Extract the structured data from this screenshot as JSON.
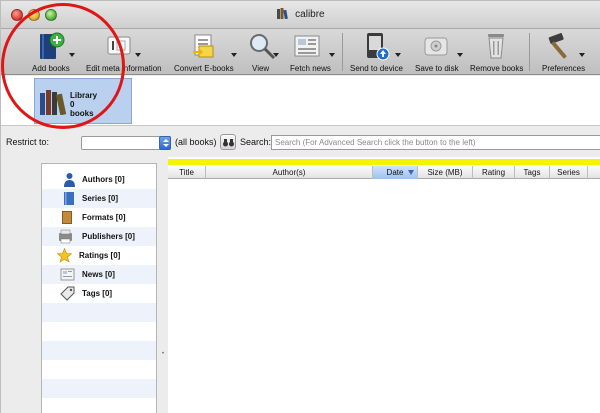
{
  "window": {
    "title": "calibre"
  },
  "toolbar": {
    "items": [
      {
        "label": "Add books",
        "icon": "add-books-icon"
      },
      {
        "label": "Edit meta information",
        "icon": "edit-metadata-icon"
      },
      {
        "label": "Convert E-books",
        "icon": "convert-icon"
      },
      {
        "label": "View",
        "icon": "view-magnifier-icon"
      },
      {
        "label": "Fetch news",
        "icon": "fetch-news-icon"
      },
      {
        "label": "Send to device",
        "icon": "send-to-device-icon"
      },
      {
        "label": "Save to disk",
        "icon": "save-to-disk-icon"
      },
      {
        "label": "Remove books",
        "icon": "trash-icon"
      },
      {
        "label": "Preferences",
        "icon": "preferences-hammer-icon"
      }
    ]
  },
  "library": {
    "line1": "Library",
    "line2": "0",
    "line3": "books"
  },
  "filter": {
    "restrict_label": "Restrict to:",
    "restrict_value": "",
    "all_books": "(all books)",
    "search_label": "Search:",
    "search_placeholder": "Search (For Advanced Search click the button to the left)"
  },
  "tag_browser": {
    "items": [
      {
        "label": "Authors [0]",
        "icon": "person-icon"
      },
      {
        "label": "Series [0]",
        "icon": "series-book-icon"
      },
      {
        "label": "Formats [0]",
        "icon": "formats-book-icon"
      },
      {
        "label": "Publishers [0]",
        "icon": "publisher-icon"
      },
      {
        "label": "Ratings [0]",
        "icon": "star-icon"
      },
      {
        "label": "News [0]",
        "icon": "news-icon"
      },
      {
        "label": "Tags [0]",
        "icon": "tag-icon"
      }
    ]
  },
  "book_list": {
    "columns": [
      "Title",
      "Author(s)",
      "Date",
      "Size (MB)",
      "Rating",
      "Tags",
      "Series"
    ],
    "sorted_column": "Date"
  },
  "colors": {
    "annotation": "#e01616",
    "highlight_bar": "#f4f400",
    "library_card": "#b9d1ee"
  }
}
